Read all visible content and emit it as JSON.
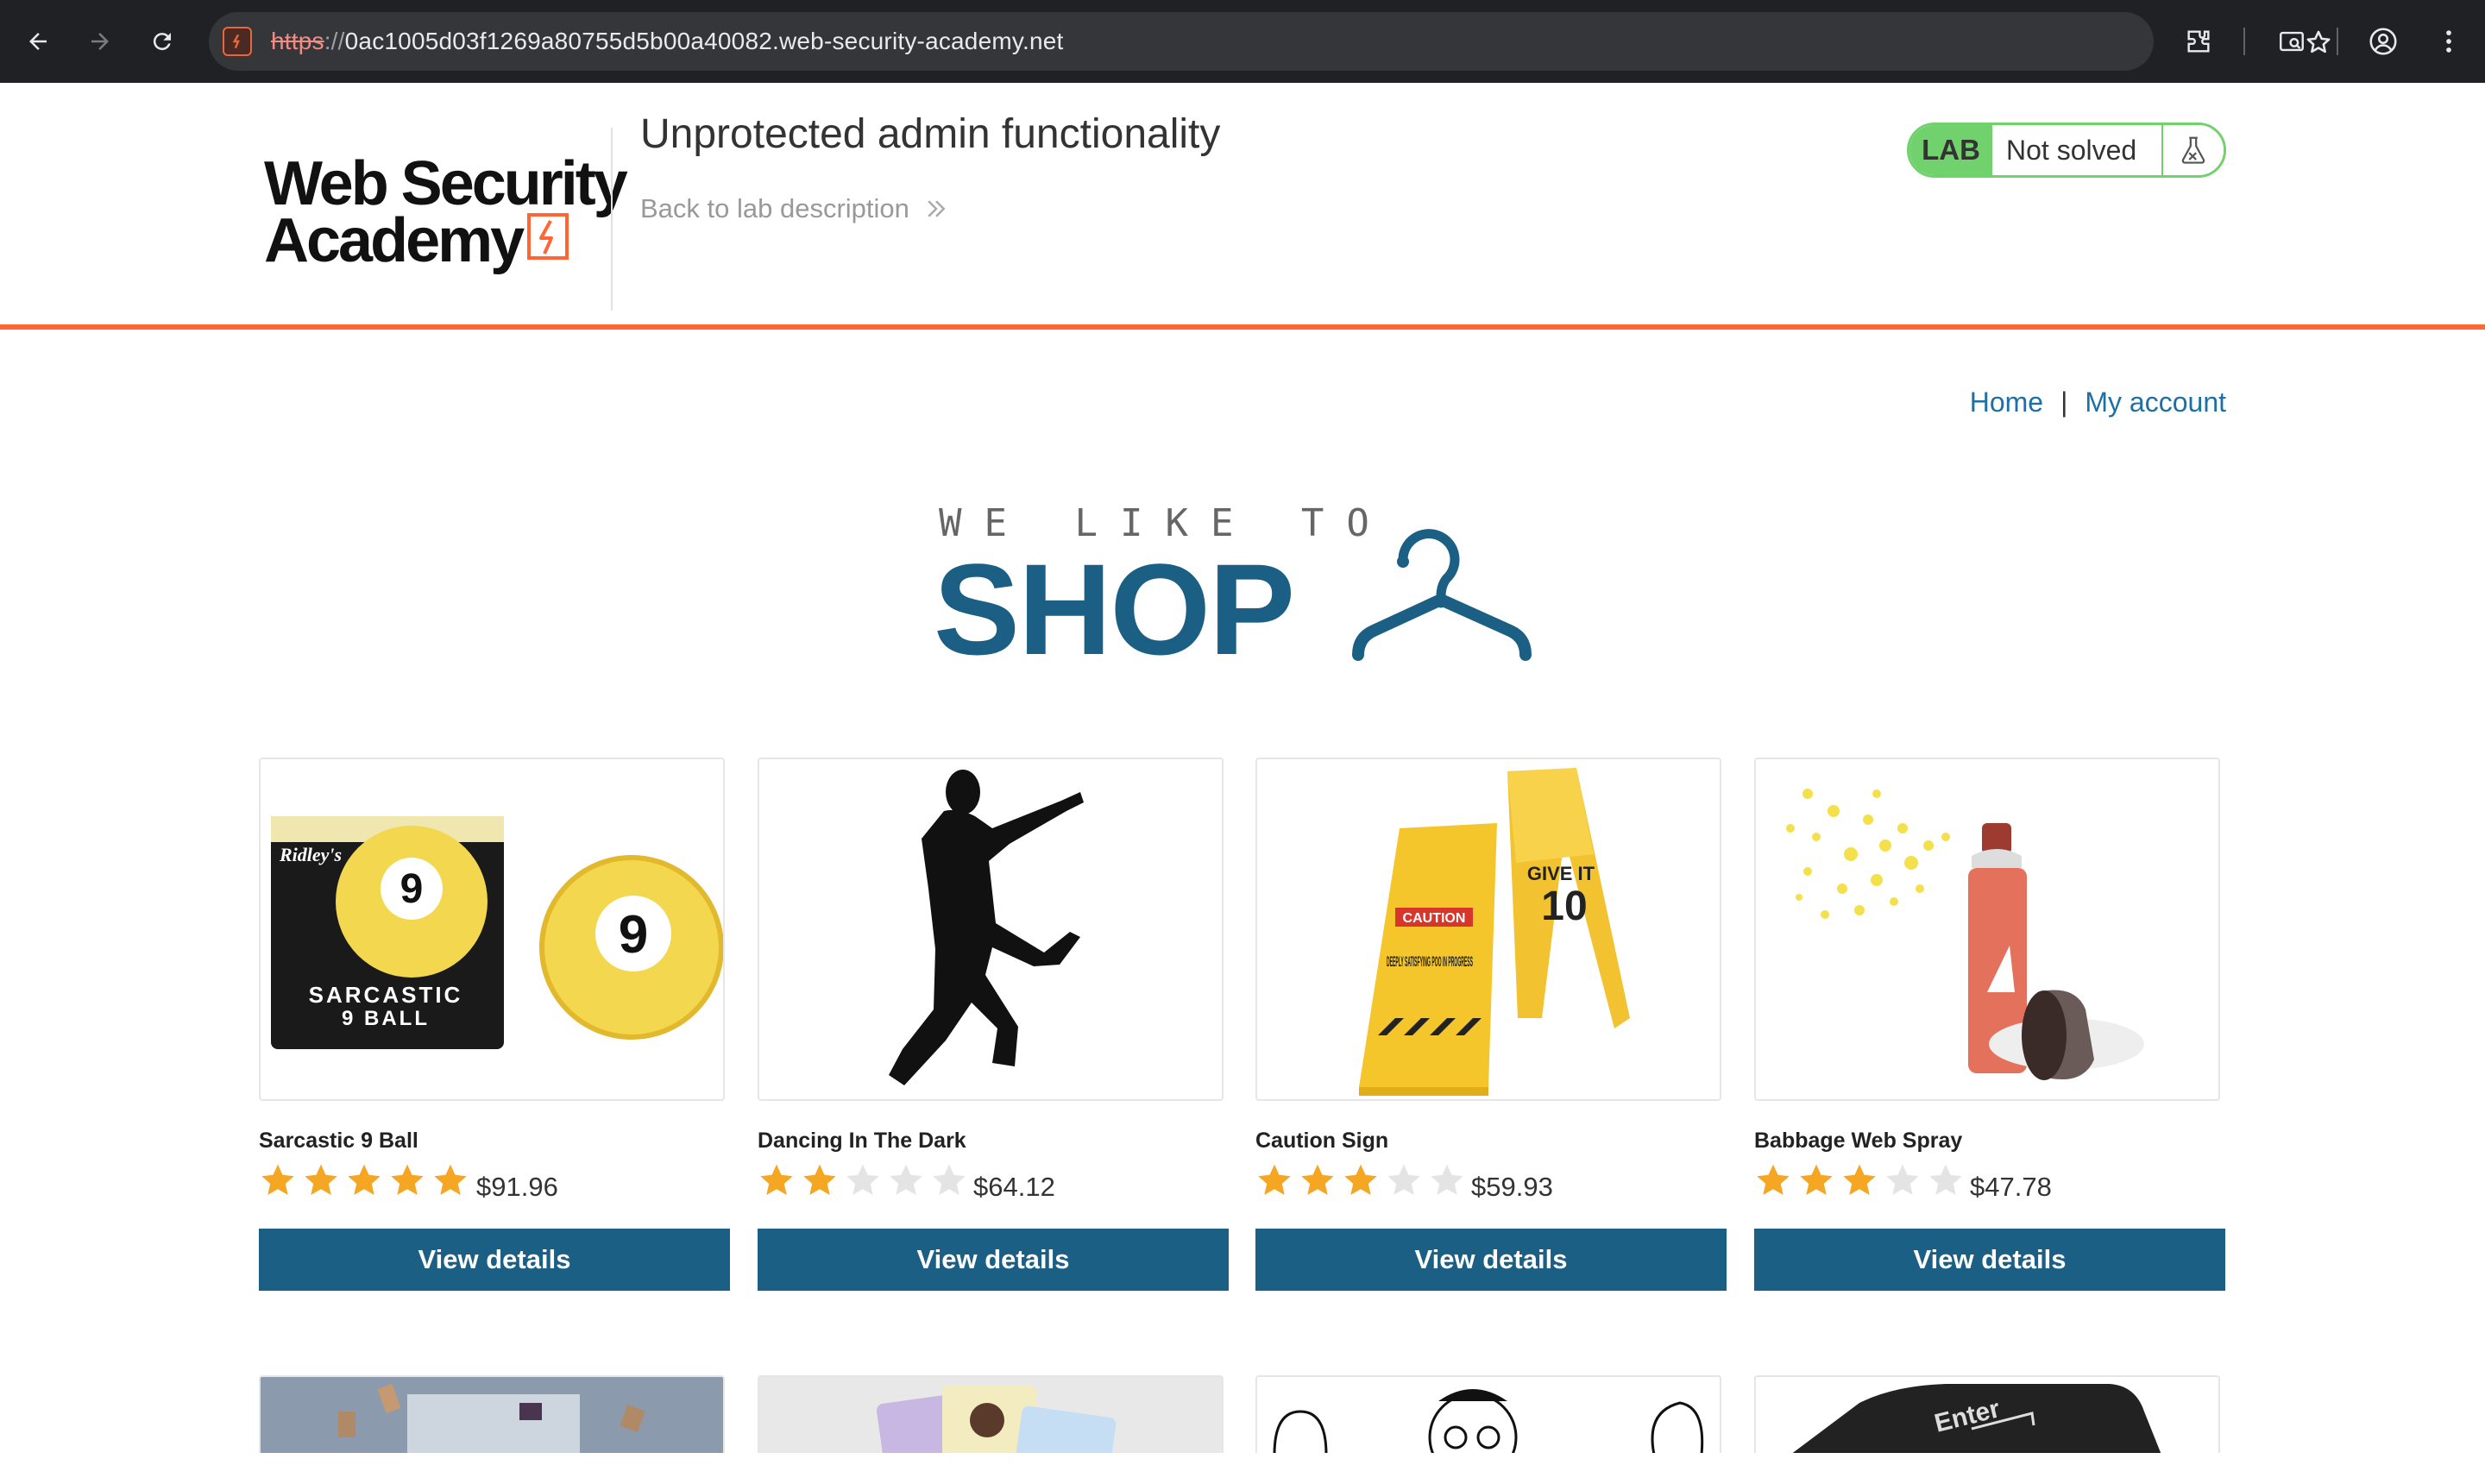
{
  "browser": {
    "url_scheme": "https",
    "url_separator": "://",
    "url_host": "0ac1005d03f1269a80755d5b00a40082.web-security-academy.net",
    "icons": [
      "back-arrow-icon",
      "forward-arrow-icon",
      "reload-icon",
      "site-info-icon",
      "bookmark-star-icon",
      "extensions-icon",
      "tab-search-icon",
      "profile-icon",
      "menu-kebab-icon"
    ]
  },
  "lab_header": {
    "logo_line1": "Web Security",
    "logo_line2": "Academy",
    "title": "Unprotected admin functionality",
    "back_link": "Back to lab description",
    "status_lab": "LAB",
    "status_text": "Not solved",
    "accent_color": "#ff6633",
    "status_color": "#70d16d"
  },
  "site_nav": {
    "home": "Home",
    "separator": "|",
    "account": "My account"
  },
  "banner": {
    "top": "WE LIKE TO",
    "main": "SHOP"
  },
  "products": [
    {
      "name": "Sarcastic 9 Ball",
      "rating": 5,
      "price": "$91.96",
      "button": "View details"
    },
    {
      "name": "Dancing In The Dark",
      "rating": 2,
      "price": "$64.12",
      "button": "View details"
    },
    {
      "name": "Caution Sign",
      "rating": 3,
      "price": "$59.93",
      "button": "View details"
    },
    {
      "name": "Babbage Web Spray",
      "rating": 3,
      "price": "$47.78",
      "button": "View details"
    }
  ],
  "product_images": {
    "p1_box_brand": "Ridley's",
    "p1_box_title": "SARCASTIC",
    "p1_box_subtitle": "9 BALL",
    "p1_ball_number": "9",
    "p3_sign_caution": "CAUTION",
    "p3_sign_text": "DEEPLY SATISFYING POO IN PROGRESS",
    "p3_sign_give": "GIVE IT",
    "p3_sign_number": "10",
    "p8_key_label": "Enter"
  },
  "theme": {
    "primary": "#1b5f84",
    "link": "#1d6fa5",
    "star_on": "#f5a623",
    "star_off": "#e4e4e4"
  }
}
